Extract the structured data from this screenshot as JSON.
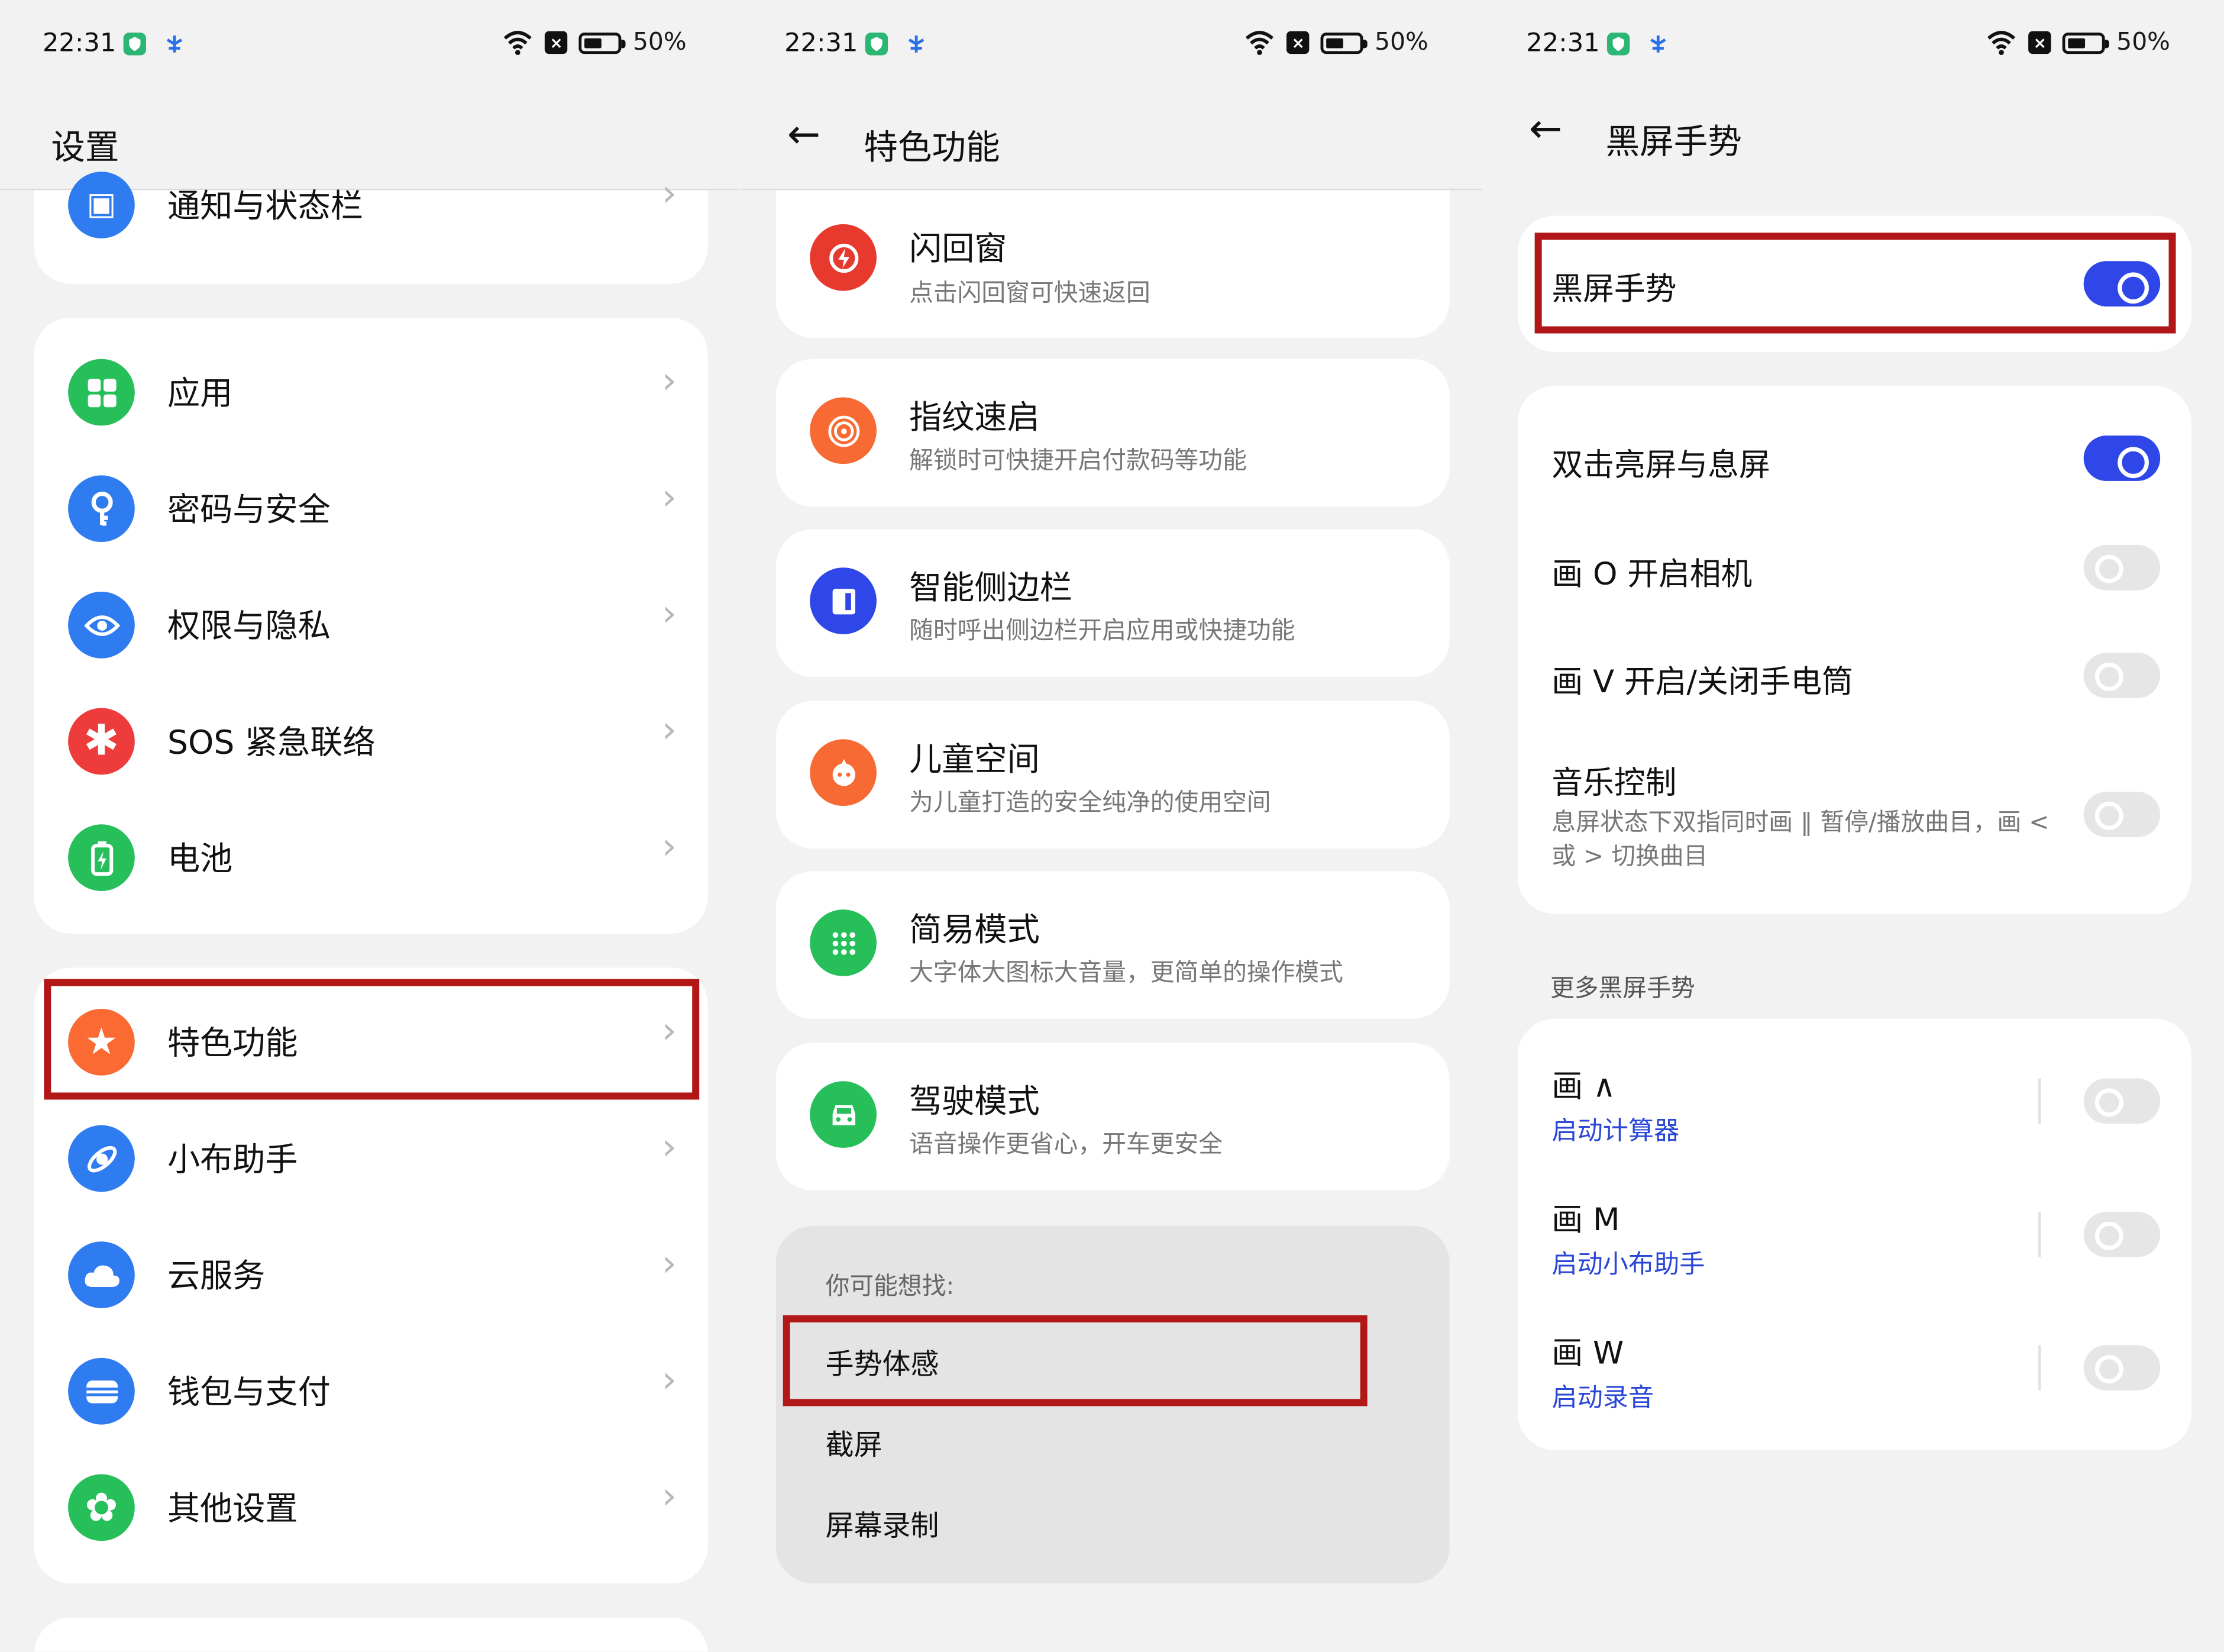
{
  "status": {
    "time": "22:31",
    "battery": "50%",
    "x_badge": "×"
  },
  "panel1": {
    "title": "设置",
    "top_item": "通知与状态栏",
    "group1": [
      "应用",
      "密码与安全",
      "权限与隐私",
      "SOS 紧急联络",
      "电池"
    ],
    "group2": [
      "特色功能",
      "小布助手",
      "云服务",
      "钱包与支付",
      "其他设置"
    ],
    "chevron": "›"
  },
  "panel2": {
    "back": "←",
    "title": "特色功能",
    "features": [
      {
        "title": "闪回窗",
        "sub": "点击闪回窗可快速返回"
      },
      {
        "title": "指纹速启",
        "sub": "解锁时可快捷开启付款码等功能"
      },
      {
        "title": "智能侧边栏",
        "sub": "随时呼出侧边栏开启应用或快捷功能"
      },
      {
        "title": "儿童空间",
        "sub": "为儿童打造的安全纯净的使用空间"
      },
      {
        "title": "简易模式",
        "sub": "大字体大图标大音量，更简单的操作模式"
      },
      {
        "title": "驾驶模式",
        "sub": "语音操作更省心，开车更安全"
      }
    ],
    "suggest": {
      "heading": "你可能想找:",
      "items": [
        "手势体感",
        "截屏",
        "屏幕录制"
      ]
    }
  },
  "panel3": {
    "back": "←",
    "title": "黑屏手势",
    "master_label": "黑屏手势",
    "master_on": true,
    "items": [
      {
        "label": "双击亮屏与息屏",
        "on": true
      },
      {
        "label": "画 O 开启相机",
        "on": false
      },
      {
        "label": "画 V 开启/关闭手电筒",
        "on": false
      },
      {
        "label": "音乐控制",
        "sub": "息屏状态下双指同时画 ‖ 暂停/播放曲目，画 < 或 > 切换曲目",
        "on": false
      }
    ],
    "more_heading": "更多黑屏手势",
    "more": [
      {
        "label": "画 ∧",
        "action": "启动计算器",
        "on": false
      },
      {
        "label": "画 M",
        "action": "启动小布助手",
        "on": false
      },
      {
        "label": "画 W",
        "action": "启动录音",
        "on": false
      }
    ]
  },
  "colors": {
    "accent": "#2f47e8",
    "highlight": "#b11717",
    "link": "#2a47d6"
  }
}
